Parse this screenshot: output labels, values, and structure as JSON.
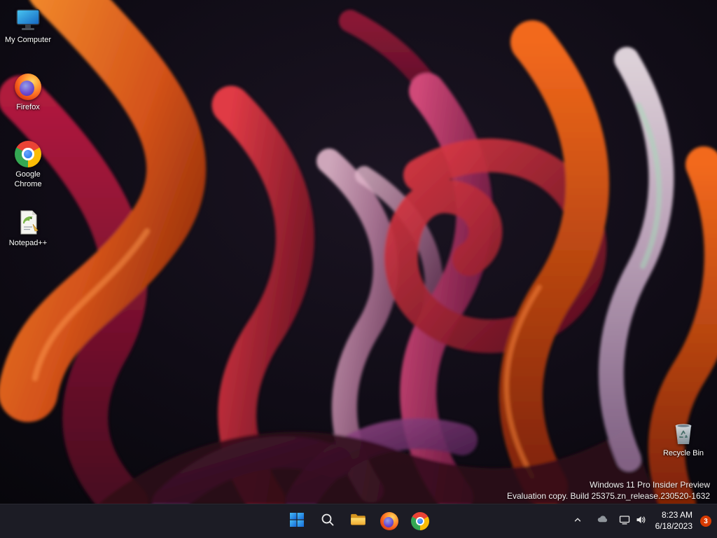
{
  "desktop": {
    "icons": [
      {
        "name": "my-computer",
        "label": "My Computer"
      },
      {
        "name": "firefox",
        "label": "Firefox"
      },
      {
        "name": "google-chrome",
        "label": "Google Chrome"
      },
      {
        "name": "notepad-plus-plus",
        "label": "Notepad++"
      },
      {
        "name": "recycle-bin",
        "label": "Recycle Bin"
      }
    ],
    "watermark": {
      "line1": "Windows 11 Pro Insider Preview",
      "line2": "Evaluation copy. Build 25375.zn_release.230520-1632"
    }
  },
  "taskbar": {
    "buttons": [
      {
        "name": "start",
        "icon": "windows-logo-icon"
      },
      {
        "name": "search",
        "icon": "search-icon"
      },
      {
        "name": "file-explorer",
        "icon": "folder-icon"
      },
      {
        "name": "firefox",
        "icon": "firefox-icon"
      },
      {
        "name": "chrome",
        "icon": "chrome-icon"
      }
    ],
    "tray": {
      "hidden_icons_chevron": "chevron-up-icon",
      "icons": [
        "onedrive-icon",
        "network-icon",
        "volume-icon"
      ],
      "time": "8:23 AM",
      "date": "6/18/2023",
      "notification_count": "3"
    }
  },
  "colors": {
    "taskbar_background": "#1d1d26",
    "notification_badge": "#d83b01",
    "wallpaper_primary_orange": "#d4531a",
    "wallpaper_crimson": "#8a1538",
    "wallpaper_background": "#0b0910"
  }
}
